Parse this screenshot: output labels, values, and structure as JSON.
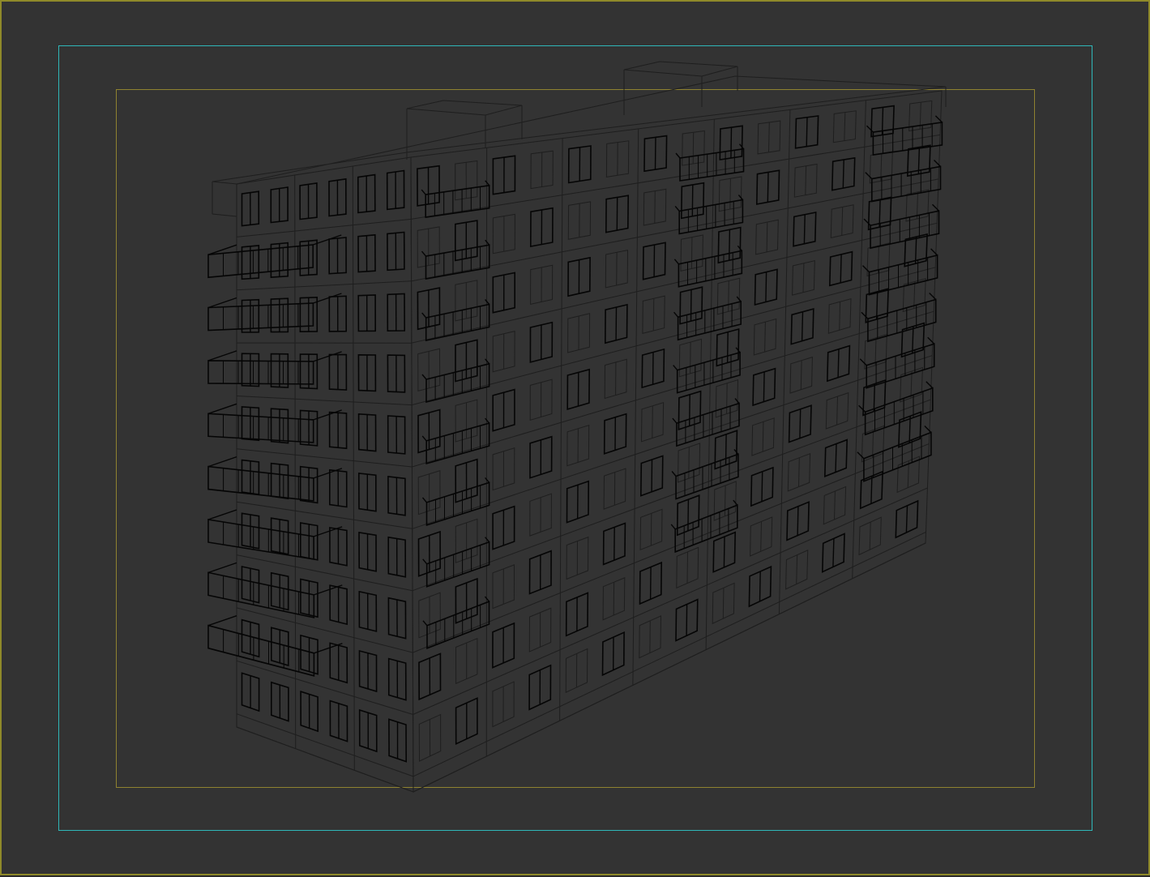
{
  "app": {
    "view": "3D viewport",
    "render_mode": "wireframe",
    "selected_outline": "none"
  },
  "colors": {
    "viewport_bg": "#333333",
    "viewport_border": "#8f8a2a",
    "action_safe_frame": "#2fb7b8",
    "title_safe_frame": "#8f8230",
    "wire_light": "#1e1e1e",
    "wire_dark": "#050505"
  },
  "scene": {
    "object": "apartment-building-wireframe",
    "floors": 10,
    "bays_left_facade": 3,
    "bays_right_facade": 7
  }
}
